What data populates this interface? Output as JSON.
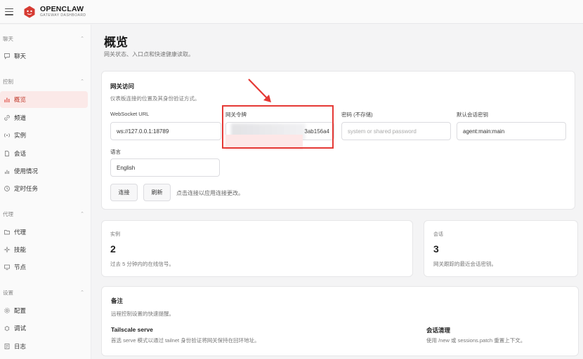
{
  "brand": {
    "name": "OPENCLAW",
    "subtitle": "GATEWAY DASHBOARD"
  },
  "sidebar": {
    "sections": [
      {
        "title": "聊天",
        "items": [
          {
            "label": "聊天",
            "icon": "chat-bubble-icon"
          }
        ]
      },
      {
        "title": "控制",
        "items": [
          {
            "label": "概览",
            "icon": "bar-chart-icon",
            "active": true
          },
          {
            "label": "频道",
            "icon": "link-icon"
          },
          {
            "label": "实例",
            "icon": "radio-icon"
          },
          {
            "label": "会话",
            "icon": "document-icon"
          },
          {
            "label": "使用情况",
            "icon": "usage-chart-icon"
          },
          {
            "label": "定时任务",
            "icon": "clock-icon"
          }
        ]
      },
      {
        "title": "代理",
        "items": [
          {
            "label": "代理",
            "icon": "folder-icon"
          },
          {
            "label": "技能",
            "icon": "sparkle-icon"
          },
          {
            "label": "节点",
            "icon": "monitor-icon"
          }
        ]
      },
      {
        "title": "设置",
        "items": [
          {
            "label": "配置",
            "icon": "gear-icon"
          },
          {
            "label": "调试",
            "icon": "bug-icon"
          },
          {
            "label": "日志",
            "icon": "log-icon"
          }
        ]
      }
    ]
  },
  "page": {
    "title": "概览",
    "subtitle": "网关状态、入口点和快速健康读取。"
  },
  "gateway": {
    "title": "网关访问",
    "subtitle": "仪表板连接的位置及其身份验证方式。",
    "websocket_label": "WebSocket URL",
    "websocket_value": "ws://127.0.0.1:18789",
    "token_label": "网关令牌",
    "token_suffix": "3ab156a4",
    "password_label": "密码 (不存储)",
    "password_placeholder": "system or shared password",
    "session_key_label": "默认会话密钥",
    "session_key_value": "agent:main:main",
    "language_label": "语言",
    "language_value": "English",
    "connect_label": "连接",
    "refresh_label": "刷新",
    "hint": "点击连接以应用连接更改。"
  },
  "stats": [
    {
      "label": "实例",
      "value": "2",
      "desc": "过去 5 分钟内的在线信号。"
    },
    {
      "label": "会话",
      "value": "3",
      "desc": "网关跟踪的最近会话密钥。"
    }
  ],
  "notes": {
    "title": "备注",
    "subtitle": "远程控制设置的快速提醒。",
    "items": [
      {
        "title": "Tailscale serve",
        "desc": "首选 serve 模式以通过 tailnet 身份验证将网关保持在回环地址。"
      },
      {
        "title": "会话清理",
        "desc": "使用 /new 或 sessions.patch 重置上下文。"
      }
    ]
  },
  "colors": {
    "accent": "#e0534a",
    "annotation": "#e53935"
  }
}
